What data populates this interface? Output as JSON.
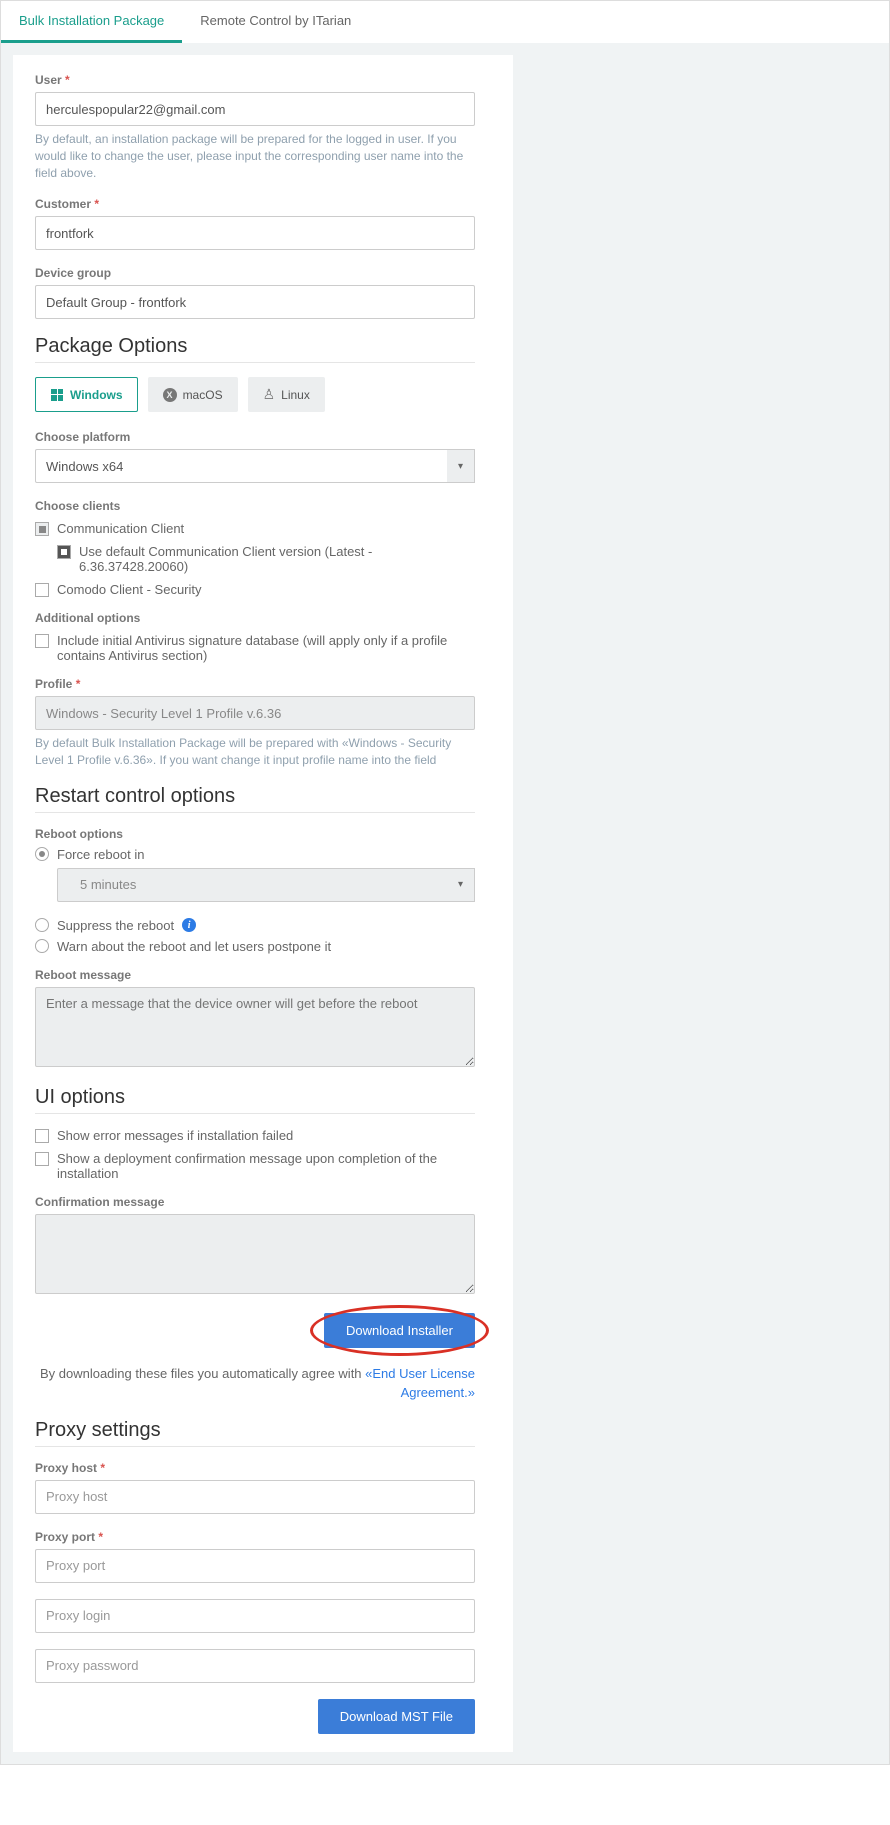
{
  "tabs": {
    "bulk": "Bulk Installation Package",
    "remote": "Remote Control by ITarian"
  },
  "user": {
    "label": "User",
    "value": "herculespopular22@gmail.com",
    "help": "By default, an installation package will be prepared for the logged in user. If you would like to change the user, please input the corresponding user name into the field above."
  },
  "customer": {
    "label": "Customer",
    "value": "frontfork"
  },
  "device_group": {
    "label": "Device group",
    "value": "Default Group - frontfork"
  },
  "package_options": {
    "title": "Package Options",
    "platforms": {
      "windows": "Windows",
      "macos": "macOS",
      "linux": "Linux"
    },
    "choose_platform_label": "Choose platform",
    "choose_platform_value": "Windows x64",
    "choose_clients_label": "Choose clients",
    "comm_client": "Communication Client",
    "comm_client_default": "Use default Communication Client version (Latest - 6.36.37428.20060)",
    "comodo_client": "Comodo Client - Security",
    "additional_label": "Additional options",
    "antivirus_opt": "Include initial Antivirus signature database (will apply only if a profile contains Antivirus section)",
    "profile_label": "Profile",
    "profile_value": "Windows - Security Level 1 Profile v.6.36",
    "profile_help": "By default Bulk Installation Package will be prepared with «Windows - Security Level 1 Profile v.6.36». If you want change it input profile name into the field"
  },
  "restart": {
    "title": "Restart control options",
    "reboot_label": "Reboot options",
    "force": "Force reboot in",
    "force_time": "5 minutes",
    "suppress": "Suppress the reboot",
    "warn": "Warn about the reboot and let users postpone it",
    "msg_label": "Reboot message",
    "msg_placeholder": "Enter a message that the device owner will get before the reboot"
  },
  "ui_options": {
    "title": "UI options",
    "show_errors": "Show error messages if installation failed",
    "show_confirm": "Show a deployment confirmation message upon completion of the installation",
    "confirm_label": "Confirmation message"
  },
  "download": {
    "installer_btn": "Download Installer",
    "agree_text": "By downloading these files you automatically agree with ",
    "agree_link": "«End User License Agreement.»"
  },
  "proxy": {
    "title": "Proxy settings",
    "host_label": "Proxy host",
    "host_placeholder": "Proxy host",
    "port_label": "Proxy port",
    "port_placeholder": "Proxy port",
    "login_placeholder": "Proxy login",
    "password_placeholder": "Proxy password",
    "mst_btn": "Download MST File"
  }
}
